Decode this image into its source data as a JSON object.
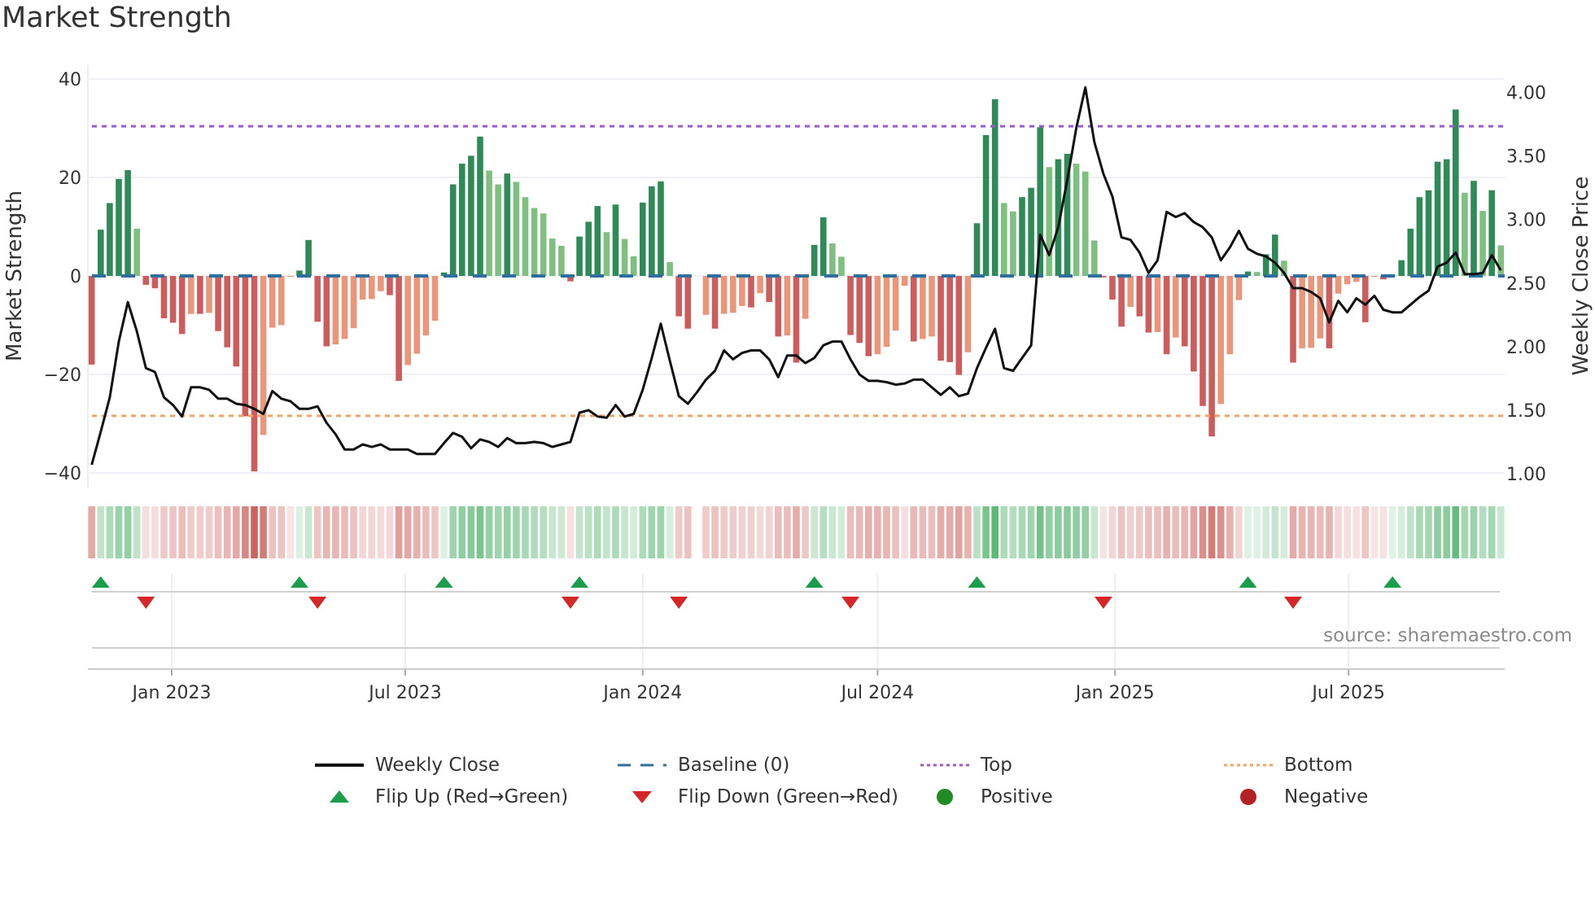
{
  "chart_data": {
    "type": "bar",
    "title": "Market Strength",
    "ylabel": "Market Strength",
    "y2label": "Weekly Close Price",
    "ylim": [
      -40,
      40
    ],
    "y2lim": [
      1.0,
      4.0
    ],
    "start_date": "2022-10-31",
    "frequency": "weekly",
    "y_ticks": [
      {
        "value": 40,
        "label": "40"
      },
      {
        "value": 20,
        "label": "20"
      },
      {
        "value": 0,
        "label": "0"
      },
      {
        "value": -20,
        "label": "−20"
      },
      {
        "value": -40,
        "label": "−40"
      }
    ],
    "y2_ticks": [
      {
        "value": 4.0,
        "label": "4.00"
      },
      {
        "value": 3.5,
        "label": "3.50"
      },
      {
        "value": 3.0,
        "label": "3.00"
      },
      {
        "value": 2.5,
        "label": "2.50"
      },
      {
        "value": 2.0,
        "label": "2.00"
      },
      {
        "value": 1.5,
        "label": "1.50"
      },
      {
        "value": 1.0,
        "label": "1.00"
      }
    ],
    "x_ticks": [
      {
        "date": "2023-01-01",
        "label": "Jan 2023"
      },
      {
        "date": "2023-07-01",
        "label": "Jul 2023"
      },
      {
        "date": "2024-01-01",
        "label": "Jan 2024"
      },
      {
        "date": "2024-07-01",
        "label": "Jul 2024"
      },
      {
        "date": "2025-01-01",
        "label": "Jan 2025"
      },
      {
        "date": "2025-07-01",
        "label": "Jul 2025"
      }
    ],
    "top_threshold": 30.4,
    "bottom_threshold": -28.4,
    "strength": [
      -18.0,
      9.4,
      14.8,
      19.7,
      21.5,
      9.6,
      -1.8,
      -2.5,
      -8.6,
      -9.5,
      -11.8,
      -7.7,
      -7.7,
      -7.5,
      -11.2,
      -14.5,
      -18.4,
      -28.5,
      -39.7,
      -32.3,
      -10.5,
      -10.0,
      -0.2,
      1.1,
      7.3,
      -9.3,
      -14.3,
      -13.9,
      -12.8,
      -10.6,
      -4.8,
      -4.7,
      -3.1,
      -3.9,
      -21.3,
      -18.1,
      -15.8,
      -12.1,
      -9.1,
      0.7,
      18.6,
      22.8,
      24.4,
      28.3,
      21.4,
      18.6,
      20.8,
      19.1,
      16.0,
      13.8,
      12.7,
      7.6,
      6.1,
      -1.1,
      8.0,
      11.0,
      14.2,
      8.9,
      14.5,
      7.5,
      4.0,
      14.9,
      18.2,
      19.2,
      2.8,
      -8.2,
      -10.7,
      null,
      -7.9,
      -10.7,
      -7.7,
      -7.5,
      -6.1,
      -6.4,
      -3.5,
      -5.3,
      -12.3,
      -12.1,
      -17.6,
      -8.7,
      6.3,
      11.9,
      6.6,
      3.9,
      -12.0,
      -13.6,
      -16.3,
      -15.9,
      -14.4,
      -11.1,
      -2.0,
      -13.3,
      -12.8,
      -12.3,
      -17.2,
      -17.5,
      -20.1,
      -15.5,
      10.7,
      28.6,
      35.9,
      14.8,
      13.1,
      16.0,
      17.9,
      30.2,
      22.1,
      23.7,
      24.8,
      22.8,
      21.2,
      7.2,
      -0.3,
      -4.8,
      -10.3,
      -6.3,
      -8.2,
      -11.5,
      -11.4,
      -15.9,
      -12.5,
      -14.3,
      -19.4,
      -26.4,
      -32.6,
      -26.0,
      -15.9,
      -4.9,
      0.9,
      0.8,
      4.4,
      8.4,
      3.1,
      -17.6,
      -14.7,
      -14.6,
      -12.7,
      -14.7,
      -3.6,
      -1.7,
      -1.2,
      -9.4,
      -0.2,
      -0.7,
      0.2,
      3.2,
      9.6,
      16.0,
      17.4,
      23.2,
      23.7,
      33.8,
      16.9,
      19.3,
      13.2,
      17.4,
      6.2
    ],
    "weekly_close": [
      1.07,
      1.33,
      1.6,
      2.04,
      2.35,
      2.12,
      1.83,
      1.8,
      1.6,
      1.54,
      1.45,
      1.68,
      1.68,
      1.66,
      1.59,
      1.59,
      1.55,
      1.54,
      1.51,
      1.47,
      1.65,
      1.59,
      1.57,
      1.51,
      1.51,
      1.53,
      1.4,
      1.31,
      1.19,
      1.19,
      1.23,
      1.21,
      1.23,
      1.19,
      1.19,
      1.19,
      1.155,
      1.155,
      1.155,
      1.24,
      1.32,
      1.29,
      1.2,
      1.27,
      1.25,
      1.21,
      1.28,
      1.24,
      1.24,
      1.25,
      1.24,
      1.21,
      1.23,
      1.25,
      1.48,
      1.5,
      1.45,
      1.44,
      1.54,
      1.45,
      1.47,
      1.66,
      1.91,
      2.18,
      1.89,
      1.61,
      1.55,
      1.64,
      1.74,
      1.81,
      1.97,
      1.9,
      1.95,
      1.97,
      1.97,
      1.9,
      1.76,
      1.93,
      1.93,
      1.87,
      1.91,
      2.01,
      2.04,
      2.04,
      1.9,
      1.78,
      1.73,
      1.73,
      1.72,
      1.7,
      1.71,
      1.74,
      1.74,
      1.68,
      1.62,
      1.68,
      1.61,
      1.63,
      1.83,
      1.99,
      2.14,
      1.83,
      1.81,
      1.91,
      2.01,
      2.88,
      2.72,
      2.94,
      3.31,
      3.72,
      4.04,
      3.61,
      3.36,
      3.18,
      2.86,
      2.84,
      2.74,
      2.58,
      2.68,
      3.06,
      3.02,
      3.05,
      2.98,
      2.94,
      2.86,
      2.68,
      2.78,
      2.91,
      2.77,
      2.73,
      2.71,
      2.66,
      2.58,
      2.46,
      2.46,
      2.43,
      2.38,
      2.19,
      2.36,
      2.27,
      2.38,
      2.33,
      2.4,
      2.29,
      2.27,
      2.27,
      2.33,
      2.39,
      2.44,
      2.63,
      2.66,
      2.74,
      2.57,
      2.57,
      2.58,
      2.72,
      2.6
    ],
    "flip_up_weeks": [
      1,
      23,
      39,
      54,
      80,
      98,
      128,
      144
    ],
    "flip_down_weeks": [
      6,
      25,
      53,
      65,
      84,
      112,
      133
    ],
    "colors": {
      "pos_rising": "#2e8b57",
      "pos_falling": "#7fbf7f",
      "neg_falling": "#cd5c5c",
      "neg_rising": "#e9967a",
      "close_line": "#111111",
      "baseline": "#2f6f9f",
      "top": "#9b59d6",
      "bottom": "#f4a460",
      "flip_up": "#1a9e4a",
      "flip_down": "#d62728",
      "positive": "#228b22",
      "negative": "#b22222"
    },
    "legend": [
      {
        "key": "weekly_close",
        "label": "Weekly Close"
      },
      {
        "key": "baseline",
        "label": "Baseline (0)"
      },
      {
        "key": "top",
        "label": "Top"
      },
      {
        "key": "bottom",
        "label": "Bottom"
      },
      {
        "key": "flip_up",
        "label": "Flip Up (Red→Green)"
      },
      {
        "key": "flip_down",
        "label": "Flip Down (Green→Red)"
      },
      {
        "key": "positive",
        "label": "Positive"
      },
      {
        "key": "negative",
        "label": "Negative"
      }
    ],
    "legend_position": "bottom-center",
    "source": "source: sharemaestro.com"
  }
}
